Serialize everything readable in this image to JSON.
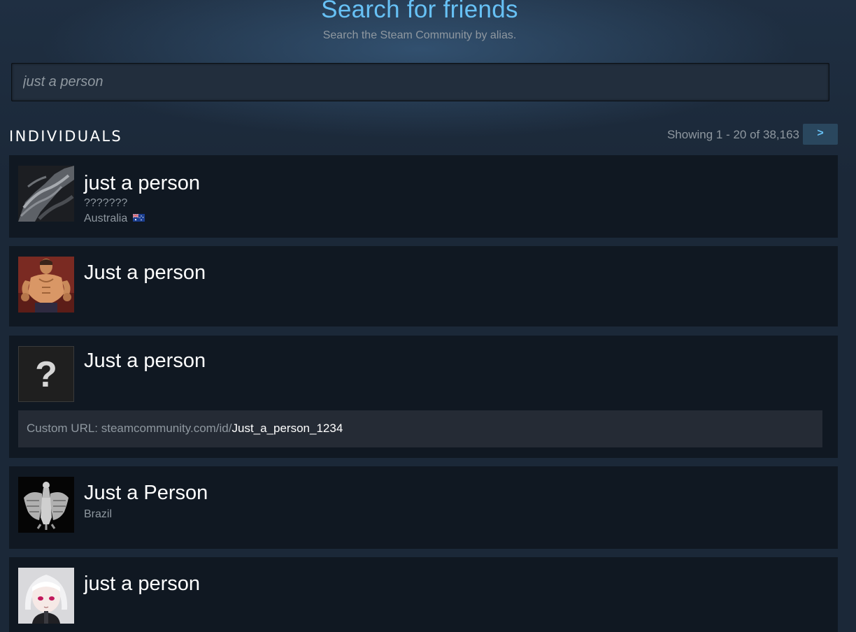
{
  "header": {
    "title": "Search for friends",
    "subtitle": "Search the Steam Community by alias."
  },
  "search": {
    "value": "",
    "placeholder": "just a person"
  },
  "results": {
    "section_label": "INDIVIDUALS",
    "paging_text": "Showing 1 - 20 of 38,163",
    "next_label": ">",
    "items": [
      {
        "name": "just a person",
        "real_name": "???????",
        "location": "Australia",
        "avatar": "dark-alien-avatar",
        "flag": "australia-flag-icon"
      },
      {
        "name": "Just a person",
        "avatar": "muscular-fighter-avatar"
      },
      {
        "name": "Just a person",
        "avatar": "default-question-mark-avatar",
        "avatar_glyph": "?",
        "custom_url_prefix": "Custom URL: steamcommunity.com/id/",
        "custom_url_id": "Just_a_person_1234"
      },
      {
        "name": "Just a Person",
        "location": "Brazil",
        "avatar": "eagle-emblem-avatar"
      },
      {
        "name": "just a person",
        "avatar": "anime-girl-avatar"
      }
    ]
  },
  "colors": {
    "background": "#1b2838",
    "accent": "#67c1f5",
    "row_background": "#101822",
    "muted_text": "#8f98a0",
    "button_background": "#2a475e"
  }
}
